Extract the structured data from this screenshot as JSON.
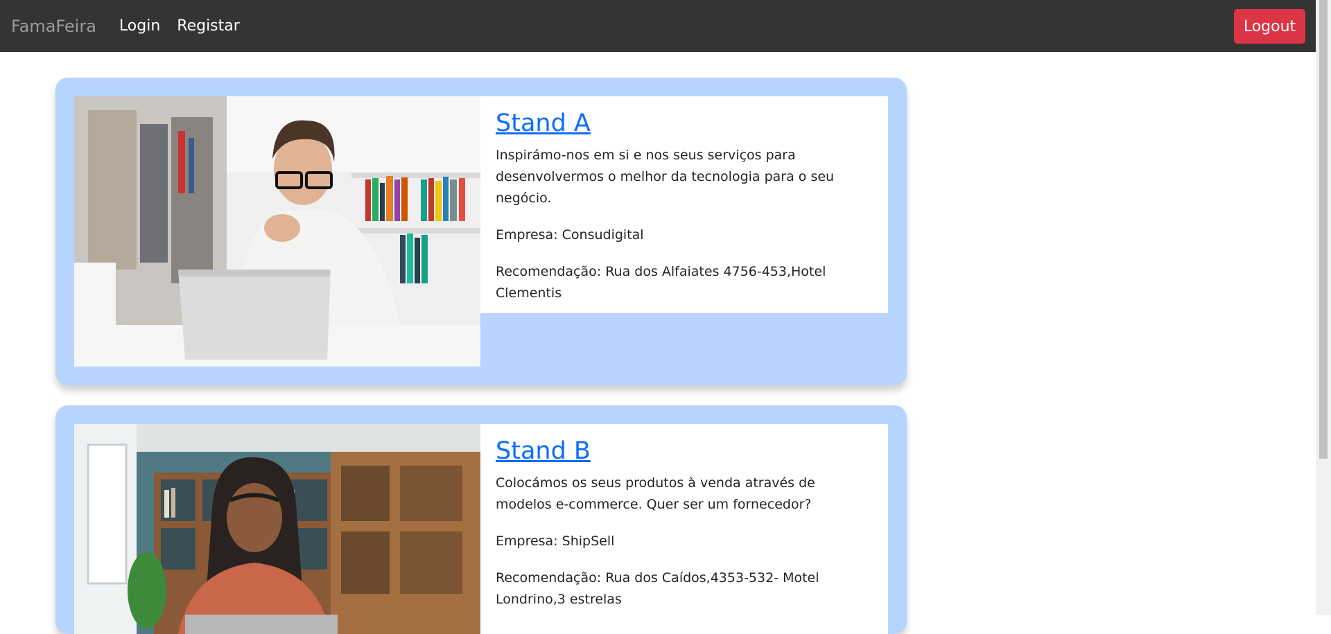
{
  "navbar": {
    "brand": "FamaFeira",
    "links": [
      "Login",
      "Registar"
    ],
    "logout_label": "Logout"
  },
  "colors": {
    "navbar_bg": "#343434",
    "card_bg": "#b6d4fe",
    "logout_bg": "#dc3545",
    "link_color": "#0d6efd"
  },
  "stands": [
    {
      "title": "Stand A",
      "description": "Inspirámo-nos em si e nos seus serviços para desenvolvermos o melhor da tecnologia para o seu negócio.",
      "company": "Empresa: Consudigital",
      "recommendation": "Recomendação: Rua dos Alfaiates 4756-453,Hotel Clementis"
    },
    {
      "title": "Stand B",
      "description": "Colocámos os seus produtos à venda através de modelos e-commerce. Quer ser um fornecedor?",
      "company": "Empresa: ShipSell",
      "recommendation": "Recomendação: Rua dos Caídos,4353-532- Motel Londrino,3 estrelas"
    }
  ]
}
